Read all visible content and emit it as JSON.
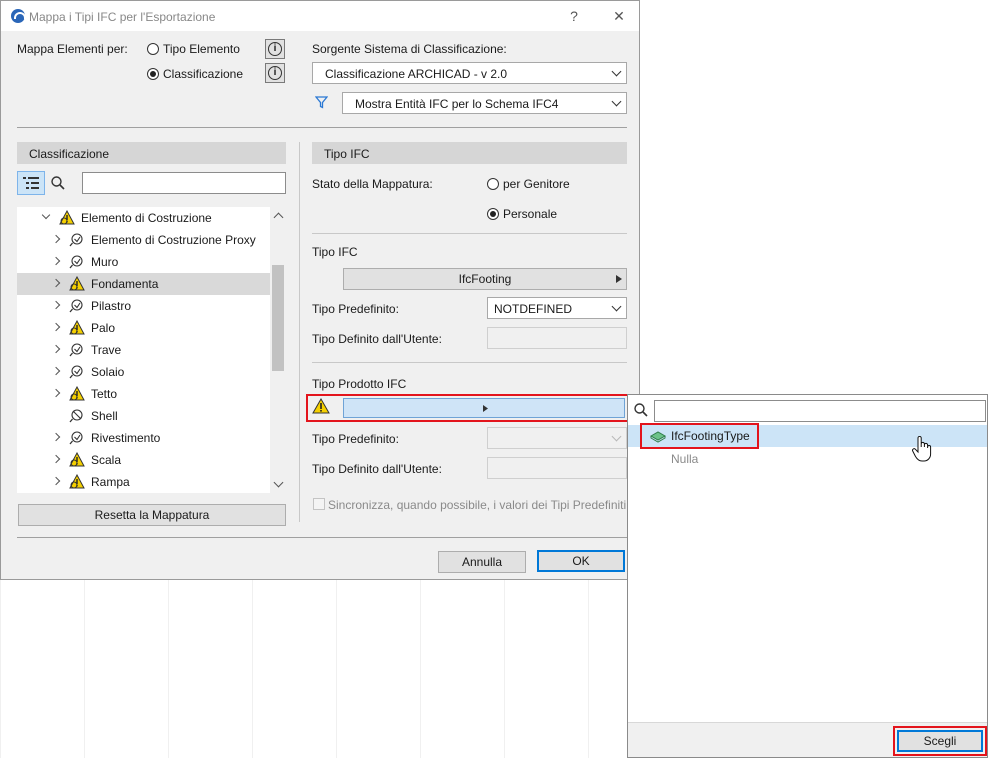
{
  "window": {
    "title": "Mappa i Tipi IFC per l'Esportazione",
    "help_glyph": "?",
    "close_glyph": "✕"
  },
  "map_by": {
    "label": "Mappa Elementi per:",
    "option_element_type": "Tipo Elemento",
    "option_classification": "Classificazione",
    "selected": "Classificazione",
    "info_glyph": "i"
  },
  "source": {
    "label": "Sorgente Sistema di Classificazione:",
    "value": "Classificazione ARCHICAD - v 2.0",
    "filter_value": "Mostra Entità IFC per lo Schema IFC4"
  },
  "left_panel": {
    "header": "Classificazione",
    "search_value": "",
    "tree": [
      {
        "label": "Elemento di Costruzione",
        "level": 0,
        "expanded": true,
        "icon": "warning-icon"
      },
      {
        "label": "Elemento di Costruzione Proxy",
        "level": 1,
        "icon": "classification-icon"
      },
      {
        "label": "Muro",
        "level": 1,
        "icon": "classification-icon"
      },
      {
        "label": "Fondamenta",
        "level": 1,
        "icon": "warning-icon",
        "selected": true
      },
      {
        "label": "Pilastro",
        "level": 1,
        "icon": "classification-icon"
      },
      {
        "label": "Palo",
        "level": 1,
        "icon": "warning-icon"
      },
      {
        "label": "Trave",
        "level": 1,
        "icon": "classification-icon"
      },
      {
        "label": "Solaio",
        "level": 1,
        "icon": "classification-icon"
      },
      {
        "label": "Tetto",
        "level": 1,
        "icon": "warning-icon"
      },
      {
        "label": "Shell",
        "level": 1,
        "icon": "unmapped-icon",
        "leaf": true
      },
      {
        "label": "Rivestimento",
        "level": 1,
        "icon": "classification-icon"
      },
      {
        "label": "Scala",
        "level": 1,
        "icon": "warning-icon"
      },
      {
        "label": "Rampa",
        "level": 1,
        "icon": "warning-icon"
      }
    ],
    "reset_button": "Resetta la Mappatura"
  },
  "right_panel": {
    "header": "Tipo IFC",
    "mapping_status_label": "Stato della Mappatura:",
    "opt_parent": "per Genitore",
    "opt_custom": "Personale",
    "mapping_selected": "Personale",
    "ifc_type_label": "Tipo IFC",
    "ifc_type_value": "IfcFooting",
    "predefined_label": "Tipo Predefinito:",
    "predefined_value": "NOTDEFINED",
    "user_defined_label": "Tipo Definito dall'Utente:",
    "user_defined_value": "",
    "product_label": "Tipo Prodotto IFC",
    "product_value": "",
    "predefined2_label": "Tipo Predefinito:",
    "predefined2_value": "",
    "user_defined2_label": "Tipo Definito dall'Utente:",
    "user_defined2_value": "",
    "sync_label": "Sincronizza, quando possibile, i valori dei Tipi Predefiniti",
    "sync_checked": false
  },
  "footer": {
    "cancel": "Annulla",
    "ok": "OK"
  },
  "popup": {
    "search_value": "",
    "items": [
      {
        "label": "IfcFootingType",
        "selected": true
      },
      {
        "label": "Nulla",
        "selected": false
      }
    ],
    "choose_button": "Scegli"
  },
  "colors": {
    "highlight_red": "#e3141c",
    "selection_blue": "#cfe4f7",
    "accent_blue": "#0078d7"
  }
}
